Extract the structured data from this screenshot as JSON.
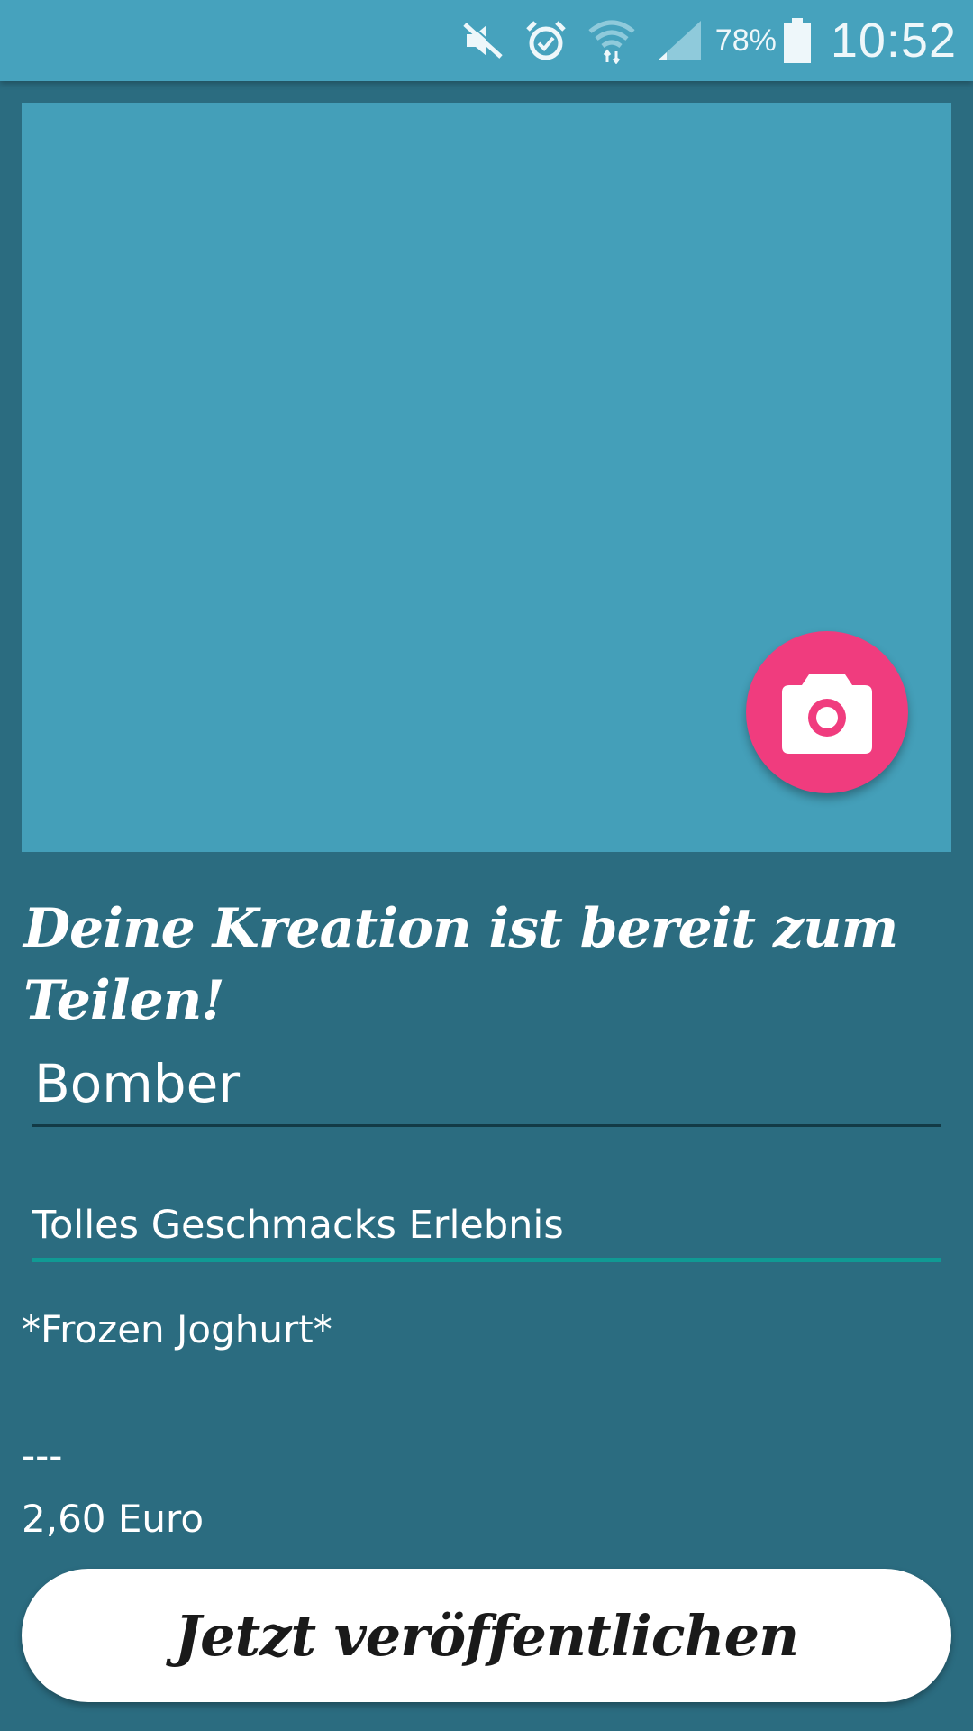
{
  "status_bar": {
    "battery_percent": "78%",
    "time": "10:52",
    "icons": [
      "mute-icon",
      "alarm-icon",
      "wifi-icon",
      "signal-icon",
      "battery-icon"
    ]
  },
  "photo": {
    "camera_button_icon": "camera-icon",
    "colors": {
      "area": "#449fb9",
      "fab": "#f03c7e"
    }
  },
  "headline": "Deine Kreation ist bereit zum Teilen!",
  "form": {
    "title_value": "Bomber",
    "description_value": "Tolles Geschmacks Erlebnis"
  },
  "details": {
    "category": "*Frozen Joghurt*",
    "separator": "---",
    "price": "2,60 Euro"
  },
  "publish_button_label": "Jetzt veröffentlichen"
}
